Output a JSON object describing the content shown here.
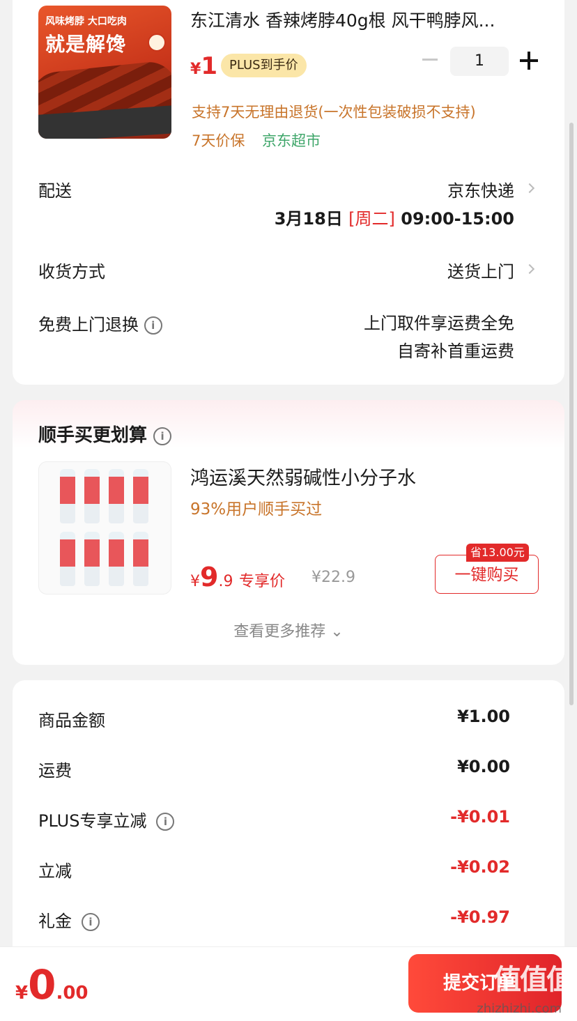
{
  "product": {
    "title": "东江清水 香辣烤脖40g根 风干鸭脖风...",
    "image_text_top": "风味烤脖 大口吃肉",
    "image_text_main": "就是解馋",
    "price_symbol": "¥",
    "price": "1",
    "plus_badge": "PLUS到手价",
    "quantity": "1",
    "return_policy": "支持7天无理由退货(一次性包装破损不支持)",
    "price_protect": "7天价保",
    "seller": "京东超市"
  },
  "delivery": {
    "label": "配送",
    "carrier": "京东快递",
    "date": "3月18日",
    "weekday": "[周二]",
    "time": "09:00-15:00"
  },
  "receive": {
    "label": "收货方式",
    "value": "送货上门"
  },
  "free_return": {
    "label": "免费上门退换",
    "line1": "上门取件享运费全免",
    "line2": "自寄补首重运费"
  },
  "recommend": {
    "title": "顺手买更划算",
    "name": "鸿运溪天然弱碱性小分子水",
    "users": "93%用户顺手买过",
    "price_symbol": "¥",
    "price_int": "9",
    "price_dec": ".9",
    "exclusive": "专享价",
    "orig_price": "¥22.9",
    "save_badge": "省13.00元",
    "buy_label": "一键购买",
    "more": "查看更多推荐 ⌄"
  },
  "summary": {
    "items": [
      {
        "label": "商品金额",
        "value": "¥1.00",
        "negative": false,
        "info": false
      },
      {
        "label": "运费",
        "value": "¥0.00",
        "negative": false,
        "info": false
      },
      {
        "label": "PLUS专享立减",
        "value": "-¥0.01",
        "negative": true,
        "info": true
      },
      {
        "label": "立减",
        "value": "-¥0.02",
        "negative": true,
        "info": false
      },
      {
        "label": "礼金",
        "value": "-¥0.97",
        "negative": true,
        "info": true
      }
    ]
  },
  "bottom": {
    "currency": "¥",
    "total_int": "0",
    "total_dec": ".00",
    "submit": "提交订单",
    "watermark": "值值值",
    "watermark_url": "zhizhizhi.com"
  },
  "colors": {
    "accent": "#e22a2a",
    "gold_text": "#c8742a",
    "green_text": "#3fa66a",
    "plus_badge_bg": "#fbe6a8"
  }
}
